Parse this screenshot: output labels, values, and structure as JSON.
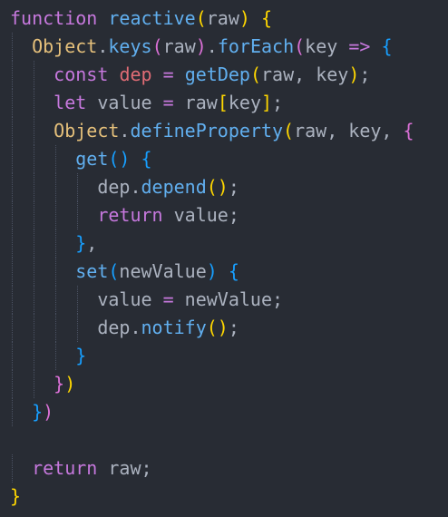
{
  "editor": {
    "colors": {
      "background": "#282c34",
      "keyword": "#c678dd",
      "function": "#61afef",
      "class": "#e5c07b",
      "variable": "#e06c75",
      "text": "#abb2bf",
      "bracket_level_1": "#ffd700",
      "bracket_level_2": "#da70d6",
      "bracket_level_3": "#179fff",
      "indent_guide": "#4b5263"
    },
    "lines": [
      [
        {
          "t": "function",
          "c": "kw"
        },
        {
          "t": " ",
          "c": "plain"
        },
        {
          "t": "reactive",
          "c": "fn"
        },
        {
          "t": "(",
          "c": "b1"
        },
        {
          "t": "raw",
          "c": "plain"
        },
        {
          "t": ")",
          "c": "b1"
        },
        {
          "t": " ",
          "c": "plain"
        },
        {
          "t": "{",
          "c": "b1"
        }
      ],
      [
        {
          "t": "  ",
          "c": "plain"
        },
        {
          "t": "Object",
          "c": "cls"
        },
        {
          "t": ".",
          "c": "plain"
        },
        {
          "t": "keys",
          "c": "fn"
        },
        {
          "t": "(",
          "c": "b2"
        },
        {
          "t": "raw",
          "c": "plain"
        },
        {
          "t": ")",
          "c": "b2"
        },
        {
          "t": ".",
          "c": "plain"
        },
        {
          "t": "forEach",
          "c": "fn"
        },
        {
          "t": "(",
          "c": "b2"
        },
        {
          "t": "key",
          "c": "plain"
        },
        {
          "t": " ",
          "c": "plain"
        },
        {
          "t": "=>",
          "c": "kw"
        },
        {
          "t": " ",
          "c": "plain"
        },
        {
          "t": "{",
          "c": "b3"
        }
      ],
      [
        {
          "t": "    ",
          "c": "plain"
        },
        {
          "t": "const",
          "c": "kw"
        },
        {
          "t": " ",
          "c": "plain"
        },
        {
          "t": "dep",
          "c": "var"
        },
        {
          "t": " ",
          "c": "plain"
        },
        {
          "t": "=",
          "c": "kw"
        },
        {
          "t": " ",
          "c": "plain"
        },
        {
          "t": "getDep",
          "c": "fn"
        },
        {
          "t": "(",
          "c": "b1"
        },
        {
          "t": "raw, key",
          "c": "plain"
        },
        {
          "t": ")",
          "c": "b1"
        },
        {
          "t": ";",
          "c": "plain"
        }
      ],
      [
        {
          "t": "    ",
          "c": "plain"
        },
        {
          "t": "let",
          "c": "kw"
        },
        {
          "t": " value ",
          "c": "plain"
        },
        {
          "t": "=",
          "c": "kw"
        },
        {
          "t": " raw",
          "c": "plain"
        },
        {
          "t": "[",
          "c": "b1"
        },
        {
          "t": "key",
          "c": "plain"
        },
        {
          "t": "]",
          "c": "b1"
        },
        {
          "t": ";",
          "c": "plain"
        }
      ],
      [
        {
          "t": "    ",
          "c": "plain"
        },
        {
          "t": "Object",
          "c": "cls"
        },
        {
          "t": ".",
          "c": "plain"
        },
        {
          "t": "defineProperty",
          "c": "fn"
        },
        {
          "t": "(",
          "c": "b1"
        },
        {
          "t": "raw, key, ",
          "c": "plain"
        },
        {
          "t": "{",
          "c": "b2"
        }
      ],
      [
        {
          "t": "      ",
          "c": "plain"
        },
        {
          "t": "get",
          "c": "fn"
        },
        {
          "t": "(",
          "c": "b3"
        },
        {
          "t": ")",
          "c": "b3"
        },
        {
          "t": " ",
          "c": "plain"
        },
        {
          "t": "{",
          "c": "b3"
        }
      ],
      [
        {
          "t": "        ",
          "c": "plain"
        },
        {
          "t": "dep.",
          "c": "plain"
        },
        {
          "t": "depend",
          "c": "fn"
        },
        {
          "t": "(",
          "c": "b1"
        },
        {
          "t": ")",
          "c": "b1"
        },
        {
          "t": ";",
          "c": "plain"
        }
      ],
      [
        {
          "t": "        ",
          "c": "plain"
        },
        {
          "t": "return",
          "c": "kw"
        },
        {
          "t": " value;",
          "c": "plain"
        }
      ],
      [
        {
          "t": "      ",
          "c": "plain"
        },
        {
          "t": "}",
          "c": "b3"
        },
        {
          "t": ",",
          "c": "plain"
        }
      ],
      [
        {
          "t": "      ",
          "c": "plain"
        },
        {
          "t": "set",
          "c": "fn"
        },
        {
          "t": "(",
          "c": "b3"
        },
        {
          "t": "newValue",
          "c": "plain"
        },
        {
          "t": ")",
          "c": "b3"
        },
        {
          "t": " ",
          "c": "plain"
        },
        {
          "t": "{",
          "c": "b3"
        }
      ],
      [
        {
          "t": "        ",
          "c": "plain"
        },
        {
          "t": "value ",
          "c": "plain"
        },
        {
          "t": "=",
          "c": "kw"
        },
        {
          "t": " newValue;",
          "c": "plain"
        }
      ],
      [
        {
          "t": "        ",
          "c": "plain"
        },
        {
          "t": "dep.",
          "c": "plain"
        },
        {
          "t": "notify",
          "c": "fn"
        },
        {
          "t": "(",
          "c": "b1"
        },
        {
          "t": ")",
          "c": "b1"
        },
        {
          "t": ";",
          "c": "plain"
        }
      ],
      [
        {
          "t": "      ",
          "c": "plain"
        },
        {
          "t": "}",
          "c": "b3"
        }
      ],
      [
        {
          "t": "    ",
          "c": "plain"
        },
        {
          "t": "}",
          "c": "b2"
        },
        {
          "t": ")",
          "c": "b1"
        }
      ],
      [
        {
          "t": "  ",
          "c": "plain"
        },
        {
          "t": "}",
          "c": "b3"
        },
        {
          "t": ")",
          "c": "b2"
        }
      ],
      [],
      [
        {
          "t": "  ",
          "c": "plain"
        },
        {
          "t": "return",
          "c": "kw"
        },
        {
          "t": " raw;",
          "c": "plain"
        }
      ],
      [
        {
          "t": "}",
          "c": "b1"
        }
      ]
    ],
    "guides": [
      [],
      [
        1
      ],
      [
        1,
        2
      ],
      [
        1,
        2
      ],
      [
        1,
        2
      ],
      [
        1,
        2,
        3
      ],
      [
        1,
        2,
        3,
        4
      ],
      [
        1,
        2,
        3,
        4
      ],
      [
        1,
        2,
        3
      ],
      [
        1,
        2,
        3
      ],
      [
        1,
        2,
        3,
        4
      ],
      [
        1,
        2,
        3,
        4
      ],
      [
        1,
        2,
        3
      ],
      [
        1,
        2
      ],
      [
        1
      ],
      [],
      [
        1
      ],
      []
    ]
  }
}
